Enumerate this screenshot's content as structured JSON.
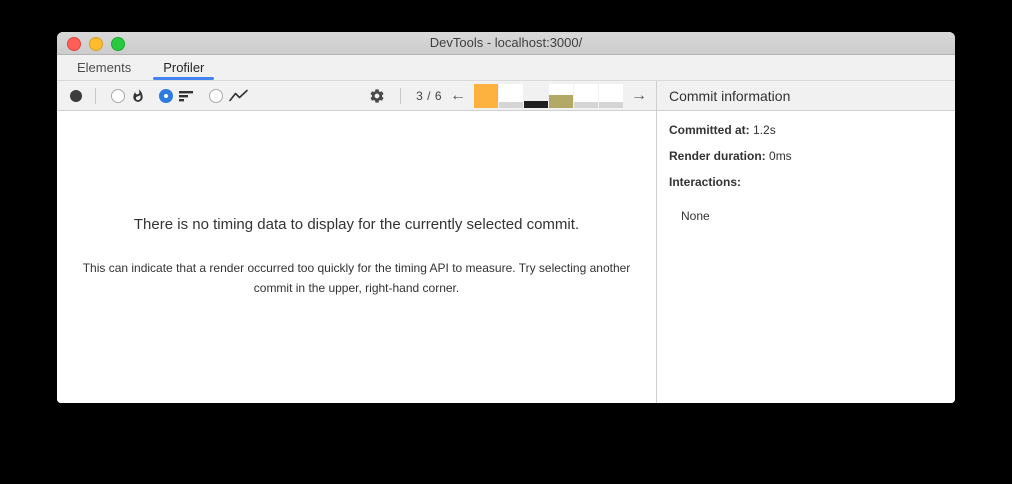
{
  "window": {
    "title": "DevTools - localhost:3000/"
  },
  "tabs": [
    {
      "label": "Elements",
      "active": false
    },
    {
      "label": "Profiler",
      "active": true
    }
  ],
  "toolbar": {
    "chart_modes": [
      {
        "name": "flamegraph",
        "icon": "flame-icon",
        "selected": false
      },
      {
        "name": "ranked",
        "icon": "ranked-bars-icon",
        "selected": true
      },
      {
        "name": "interactions",
        "icon": "interactions-chart-icon",
        "selected": false
      }
    ],
    "icons": {
      "record": "record-circle-icon",
      "settings": "gear-icon",
      "prev_commit": "left-arrow-icon",
      "next_commit": "right-arrow-icon"
    },
    "commit_selector": {
      "position_label": "3 / 6",
      "prev_icon": "←",
      "next_icon": "→"
    }
  },
  "commit_bars": {
    "selected_index": 2,
    "bars": [
      {
        "height_pct": 100,
        "color": "#fcb23c",
        "slot_bg": "#ffffff"
      },
      {
        "height_pct": 25,
        "color": "#d5d5d5",
        "slot_bg": "#ffffff"
      },
      {
        "height_pct": 29,
        "color": "#1f1f1f",
        "slot_bg": "#f1f1f1"
      },
      {
        "height_pct": 54,
        "color": "#b1a965",
        "slot_bg": "#ffffff"
      },
      {
        "height_pct": 21,
        "color": "#d5d5d5",
        "slot_bg": "#ffffff"
      },
      {
        "height_pct": 21,
        "color": "#d5d5d5",
        "slot_bg": "#ffffff"
      }
    ]
  },
  "main": {
    "heading": "There is no timing data to display for the currently selected commit.",
    "body": "This can indicate that a render occurred too quickly for the timing API to measure. Try selecting another commit in the upper, right-hand corner."
  },
  "sidebar": {
    "title": "Commit information",
    "rows": [
      {
        "label": "Committed at:",
        "value": "1.2s"
      },
      {
        "label": "Render duration:",
        "value": "0ms"
      },
      {
        "label": "Interactions:",
        "value": ""
      }
    ],
    "interactions_none": "None"
  },
  "colors": {
    "accent_blue": "#2d7ce0",
    "tab_underline": "#4483f2",
    "commit_orange": "#fcb23c",
    "commit_olive": "#b1a965",
    "commit_selected": "#1f1f1f"
  }
}
